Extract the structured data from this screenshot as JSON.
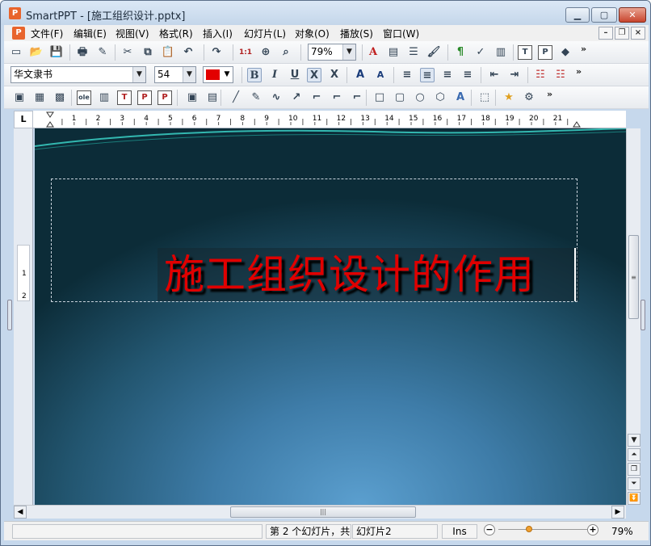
{
  "window": {
    "app_icon": "P",
    "title": "SmartPPT - [施工组织设计.pptx]",
    "controls": {
      "minimize": "▁",
      "maximize": "▢",
      "close": "✕"
    }
  },
  "menubar": {
    "doc_icon": "P",
    "items": [
      "文件(F)",
      "编辑(E)",
      "视图(V)",
      "格式(R)",
      "插入(I)",
      "幻灯片(L)",
      "对象(O)",
      "播放(S)",
      "窗口(W)"
    ],
    "mdi": {
      "minimize": "–",
      "restore": "❐",
      "close": "×"
    }
  },
  "toolbar1": {
    "icons": [
      {
        "name": "new-icon",
        "glyph": "▭"
      },
      {
        "name": "open-icon",
        "glyph": "📂"
      },
      {
        "name": "save-icon",
        "glyph": "💾"
      },
      {
        "name": "print-icon",
        "glyph": "🖶"
      },
      {
        "name": "pdf-icon",
        "glyph": "✎"
      },
      {
        "name": "cut-icon",
        "glyph": "✂"
      },
      {
        "name": "copy-icon",
        "glyph": "⧉"
      },
      {
        "name": "paste-icon",
        "glyph": "📋"
      },
      {
        "name": "undo-icon",
        "glyph": "↶"
      },
      {
        "name": "redo-icon",
        "glyph": "↷"
      },
      {
        "name": "actual-size-icon",
        "glyph": "1:1"
      },
      {
        "name": "zoom-fit-icon",
        "glyph": "⊕"
      },
      {
        "name": "magnifier-icon",
        "glyph": "⌕"
      },
      {
        "name": "font-color-a-icon",
        "glyph": "A"
      },
      {
        "name": "insert-text-icon",
        "glyph": "▤"
      },
      {
        "name": "list-icon",
        "glyph": "☰"
      },
      {
        "name": "format-painter-icon",
        "glyph": "🖌"
      },
      {
        "name": "paragraph-mark-icon",
        "glyph": "¶"
      },
      {
        "name": "spellcheck-icon",
        "glyph": "✓"
      },
      {
        "name": "stats-icon",
        "glyph": "▥"
      },
      {
        "name": "frame-t-icon",
        "glyph": "T"
      },
      {
        "name": "frame-p-icon",
        "glyph": "P"
      },
      {
        "name": "layers-icon",
        "glyph": "◆"
      }
    ],
    "zoom_value": "79%",
    "more": "»"
  },
  "toolbar2": {
    "font_name": "华文隶书",
    "font_size": "54",
    "font_color": "#e30000",
    "bold": "B",
    "italic": "I",
    "underline": "U",
    "strike_x": "X",
    "clear_x": "X",
    "grow": "A",
    "shrink": "A",
    "align_icons": [
      "≡",
      "≡",
      "≡",
      "≡"
    ],
    "indent_icons": [
      "⇤",
      "⇥"
    ],
    "bullet_icons": [
      "☷",
      "☷"
    ],
    "more": "»"
  },
  "toolbar3": {
    "icons": [
      "▣",
      "▦",
      "▩",
      "ole",
      "▥",
      "T",
      "P",
      "P",
      "▣",
      "▤",
      "╱",
      "✎",
      "∿",
      "↗",
      "⌐",
      "⌐",
      "⌐",
      "□",
      "▢",
      "○",
      "⬡",
      "A",
      "⬚",
      "★",
      "⚙"
    ],
    "more": "»"
  },
  "ruler": {
    "corner": "L",
    "marks": [
      "1",
      "2",
      "3",
      "4",
      "5",
      "6",
      "7",
      "8",
      "9",
      "10",
      "11",
      "12",
      "13",
      "14",
      "15",
      "16",
      "17",
      "18",
      "19",
      "20",
      "21"
    ],
    "vertical_marks": [
      "1",
      "2"
    ]
  },
  "slide": {
    "title": "施工组织设计的作用",
    "bg_colors": [
      "#5b9fcf",
      "#0c2c38"
    ],
    "title_color": "#e00000"
  },
  "statusbar": {
    "blank": "",
    "slide_info": "第 2 个幻灯片，共",
    "slide_name": "幻灯片2",
    "mode": "Ins",
    "zoom_minus": "−",
    "zoom_plus": "+",
    "zoom": "79%"
  }
}
